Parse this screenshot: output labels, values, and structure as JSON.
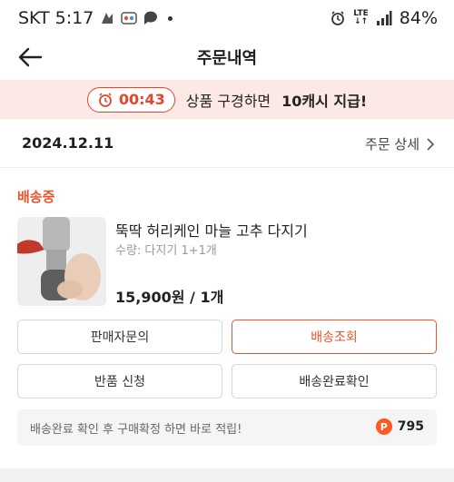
{
  "status_bar": {
    "carrier": "SKT",
    "time": "5:17",
    "battery": "84%",
    "network": "LTE"
  },
  "header": {
    "title": "주문내역"
  },
  "banner": {
    "timer": "00:43",
    "message": "상품 구경하면",
    "reward": "10캐시 지급!"
  },
  "order": {
    "date": "2024.12.11",
    "detail_link": "주문 상세"
  },
  "shipment": {
    "status": "배송중"
  },
  "product": {
    "name": "뚝딱 허리케인 마늘 고추 다지기",
    "option": "수량: 다지기 1+1개",
    "price": "15,900원 / 1개"
  },
  "actions": {
    "seller_inquiry": "판매자문의",
    "track_delivery": "배송조회",
    "return_request": "반품 신청",
    "confirm_delivery": "배송완료확인"
  },
  "reward_bar": {
    "message": "배송완료 확인 후 구매확정 하면 바로 적립!",
    "badge": "P",
    "points": "795"
  },
  "colors": {
    "accent": "#e8552c",
    "banner_bg": "#fce9e6"
  }
}
